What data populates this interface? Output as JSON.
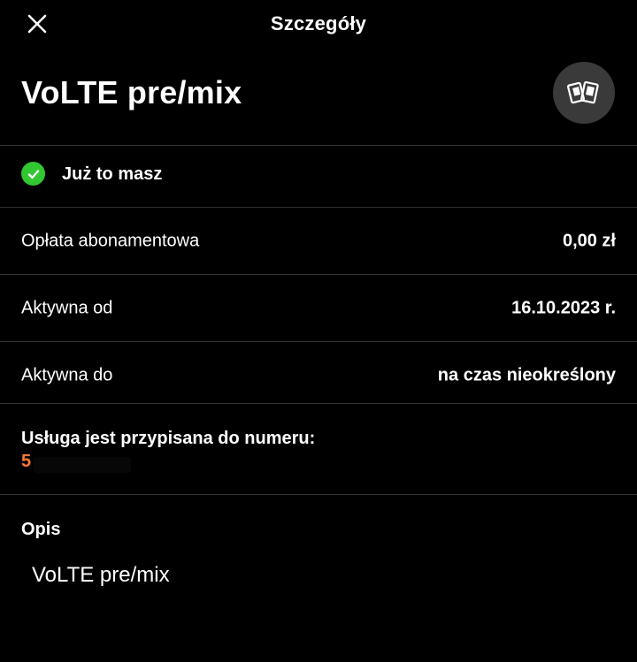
{
  "header": {
    "title": "Szczegóły",
    "close_icon": "close-icon"
  },
  "service": {
    "name": "VoLTE pre/mix",
    "badge_icon": "cards-icon"
  },
  "status": {
    "label": "Już to masz",
    "icon": "check-circle-icon",
    "color": "#32c832"
  },
  "details": [
    {
      "label": "Opłata abonamentowa",
      "value": "0,00 zł"
    },
    {
      "label": "Aktywna od",
      "value": "16.10.2023 r."
    },
    {
      "label": "Aktywna do",
      "value": "na czas nieokreślony"
    }
  ],
  "assigned": {
    "label": "Usługa jest przypisana do numeru:",
    "number_visible": "5",
    "number_color": "#ff7a32"
  },
  "description": {
    "heading": "Opis",
    "text": "VoLTE pre/mix"
  }
}
